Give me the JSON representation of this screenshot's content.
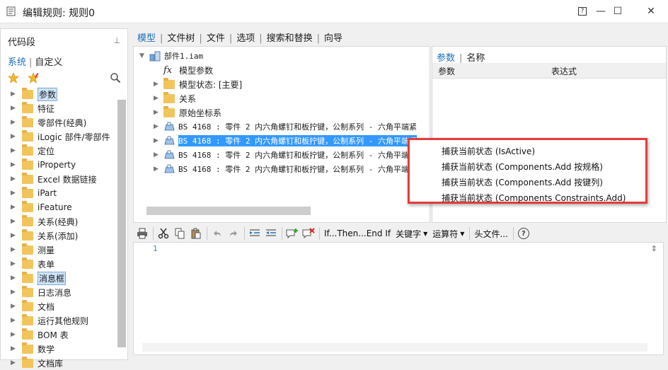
{
  "window": {
    "title": "编辑规则: 规则0",
    "help_button": "?",
    "minimize_button": "—",
    "maximize_button": "☐",
    "close_button": "✕"
  },
  "snippets_panel": {
    "header": "代码段",
    "pin": "⊥",
    "tabs": [
      {
        "label": "系统",
        "active": true
      },
      {
        "label": "自定义",
        "active": false
      }
    ],
    "items": [
      {
        "label": "参数",
        "highlighted": true
      },
      {
        "label": "特征",
        "highlighted": false
      },
      {
        "label": "零部件(经典)",
        "highlighted": false
      },
      {
        "label": "iLogic 部件/零部件",
        "highlighted": false
      },
      {
        "label": "定位",
        "highlighted": false
      },
      {
        "label": "iProperty",
        "highlighted": false
      },
      {
        "label": "Excel 数据链接",
        "highlighted": false
      },
      {
        "label": "iPart",
        "highlighted": false
      },
      {
        "label": "iFeature",
        "highlighted": false
      },
      {
        "label": "关系(经典)",
        "highlighted": false
      },
      {
        "label": "关系(添加)",
        "highlighted": false
      },
      {
        "label": "测量",
        "highlighted": false
      },
      {
        "label": "表单",
        "highlighted": false
      },
      {
        "label": "消息框",
        "highlighted": true
      },
      {
        "label": "日志消息",
        "highlighted": false
      },
      {
        "label": "文档",
        "highlighted": false
      },
      {
        "label": "运行其他规则",
        "highlighted": false
      },
      {
        "label": "BOM 表",
        "highlighted": false
      },
      {
        "label": "数学",
        "highlighted": false
      },
      {
        "label": "文档库",
        "highlighted": false
      }
    ]
  },
  "menubar": [
    {
      "label": "模型",
      "active": true
    },
    {
      "label": "文件树",
      "active": false
    },
    {
      "label": "文件",
      "active": false
    },
    {
      "label": "选项",
      "active": false
    },
    {
      "label": "搜索和替换",
      "active": false
    },
    {
      "label": "向导",
      "active": false
    }
  ],
  "model_tree": {
    "root": "部件1.iam",
    "items": [
      {
        "label": "模型参数",
        "icon": "fx-icon"
      },
      {
        "label": "模型状态: [主要]",
        "icon": "folder-icon"
      },
      {
        "label": "关系",
        "icon": "folder-icon"
      },
      {
        "label": "原始坐标系",
        "icon": "folder-icon"
      },
      {
        "label": "BS 4168 : 零件 2 内六角螺钉和板拧键，公制系列 - 六角平端紧",
        "icon": "part-icon",
        "selected": false
      },
      {
        "label": "BS 4168 : 零件 2 内六角螺钉和板拧键，公制系列 - 六角平端紧",
        "icon": "part-icon",
        "selected": true
      },
      {
        "label": "BS 4168 : 零件 2 内六角螺钉和板拧键，公制系列 - 六角平端",
        "icon": "part-icon",
        "selected": false
      },
      {
        "label": "BS 4168 : 零件 2 内六角螺钉和板拧键，公制系列 - 六角平端",
        "icon": "part-icon",
        "selected": false
      }
    ]
  },
  "parameters_pane": {
    "tabs": [
      {
        "label": "参数",
        "active": true
      },
      {
        "label": "名称",
        "active": false
      }
    ],
    "columns": [
      "参数",
      "表达式"
    ]
  },
  "context_menu": {
    "items": [
      "捕获当前状态 (IsActive)",
      "捕获当前状态 (Components.Add 按规格)",
      "捕获当前状态 (Components.Add 按键列)",
      "捕获当前状态 (Components Constraints.Add)"
    ],
    "border_color": "#e53b3b"
  },
  "editor_toolbar": {
    "if_then": "If...Then...End If",
    "keywords": "关键字",
    "operators": "运算符",
    "header": "头文件...",
    "help": "?"
  },
  "editor": {
    "line_numbers": [
      "1"
    ]
  },
  "colors": {
    "accent": "#1f6fb5",
    "selection": "#3399ff",
    "folder": "#f2c55c"
  }
}
